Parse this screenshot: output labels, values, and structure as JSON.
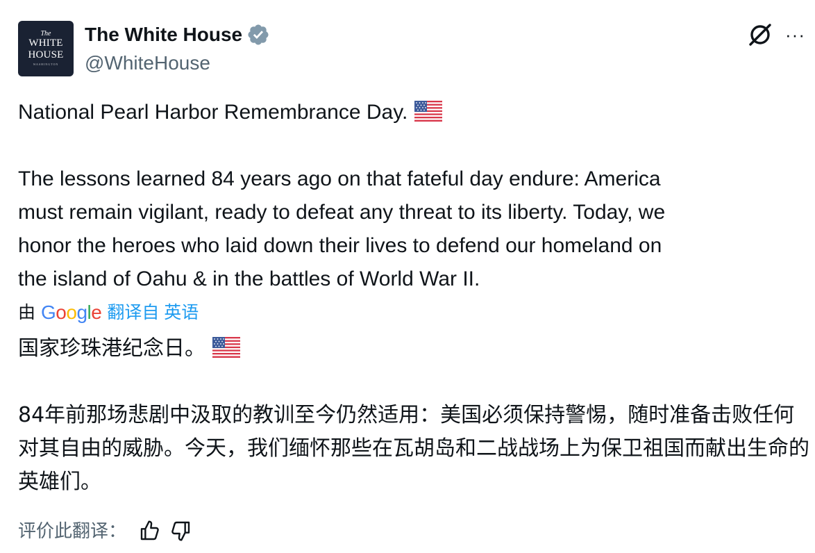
{
  "account": {
    "avatar_line1": "The",
    "avatar_line2": "WHITE",
    "avatar_line3": "HOUSE",
    "avatar_line4": "WASHINGTON",
    "display_name": "The White House",
    "handle": "@WhiteHouse",
    "verified_color": "#829aab"
  },
  "icons": {
    "grok": "grok-icon",
    "more": "more-icon",
    "verified": "verified-badge-icon",
    "flag": "us-flag-emoji",
    "thumbs_up": "thumbs-up-icon",
    "thumbs_down": "thumbs-down-icon"
  },
  "more_glyph": "···",
  "post": {
    "line1": "National Pearl Harbor Remembrance Day.",
    "body": "The lessons learned 84 years ago on that fateful day endure: America\nmust remain vigilant, ready to defeat any threat to its liberty. Today, we\nhonor the heroes who laid down their lives to defend our homeland on\nthe island of Oahu & in the battles of World War II."
  },
  "translation": {
    "by_prefix": "由",
    "provider": "Google",
    "link": "翻译自 英语",
    "link_color": "#1d9bf0",
    "line1": "国家珍珠港纪念日。",
    "body": "84年前那场悲剧中汲取的教训至今仍然适用：美国必须保持警惕，随时准备击败任何对其自由的威胁。今天，我们缅怀那些在瓦胡岛和二战战场上为保卫祖国而献出生命的英雄们。",
    "rate_label": "评价此翻译："
  }
}
